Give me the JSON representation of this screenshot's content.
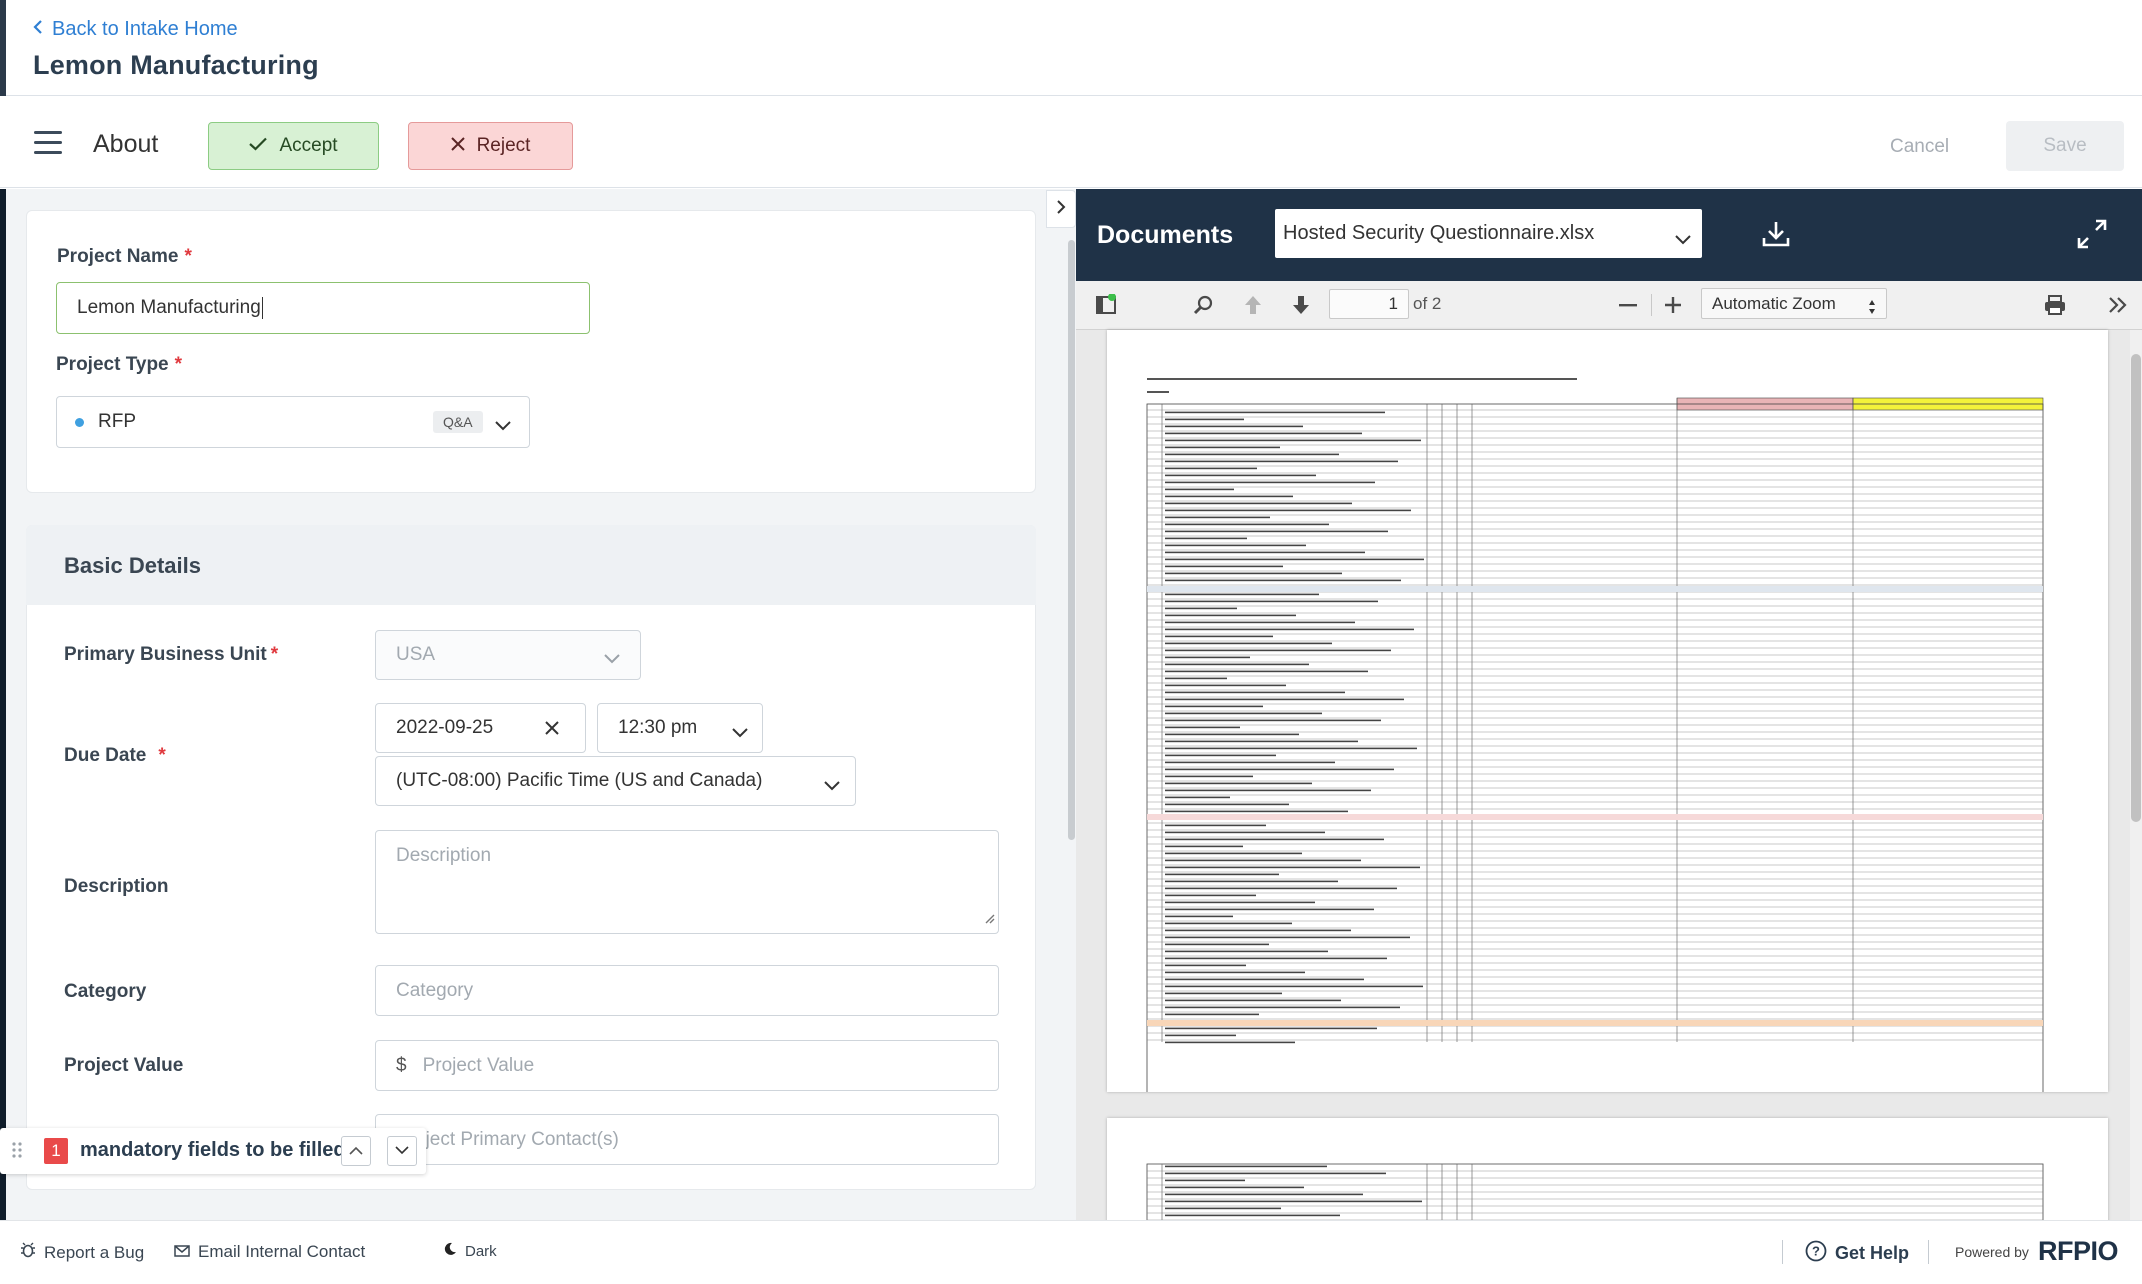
{
  "header": {
    "back_link": "Back to Intake Home",
    "title": "Lemon Manufacturing"
  },
  "toolbar": {
    "section": "About",
    "accept_label": "Accept",
    "reject_label": "Reject",
    "cancel_label": "Cancel",
    "save_label": "Save"
  },
  "project": {
    "name_label": "Project Name",
    "name_value": "Lemon Manufacturing",
    "type_label": "Project Type",
    "type_value": "RFP",
    "type_tag": "Q&A"
  },
  "basic_details": {
    "title": "Basic Details",
    "business_unit_label": "Primary Business Unit",
    "business_unit_value": "USA",
    "due_date_label": "Due Date",
    "due_date_value": "2022-09-25",
    "due_time_value": "12:30 pm",
    "timezone_value": "(UTC-08:00) Pacific Time (US and Canada)",
    "description_label": "Description",
    "description_placeholder": "Description",
    "category_label": "Category",
    "category_placeholder": "Category",
    "value_label": "Project Value",
    "value_currency": "$",
    "value_placeholder": "Project Value",
    "contact_placeholder": "Project Primary Contact(s)"
  },
  "mandatory": {
    "count": "1",
    "text": "mandatory fields to be filled"
  },
  "documents": {
    "title": "Documents",
    "selected_file": "Hosted Security Questionnaire.xlsx",
    "page_current": "1",
    "page_of": "of 2",
    "zoom": "Automatic Zoom"
  },
  "footer": {
    "report_bug": "Report a Bug",
    "email_contact": "Email Internal Contact",
    "theme": "Dark",
    "get_help": "Get Help",
    "powered_by": "Powered by",
    "brand": "RFPIO"
  },
  "colors": {
    "accent_blue": "#2f7fd3",
    "accept_bg": "#d8f1d4",
    "reject_bg": "#fbd6d6",
    "doc_header": "#1f3247",
    "required_red": "#e0393e"
  }
}
